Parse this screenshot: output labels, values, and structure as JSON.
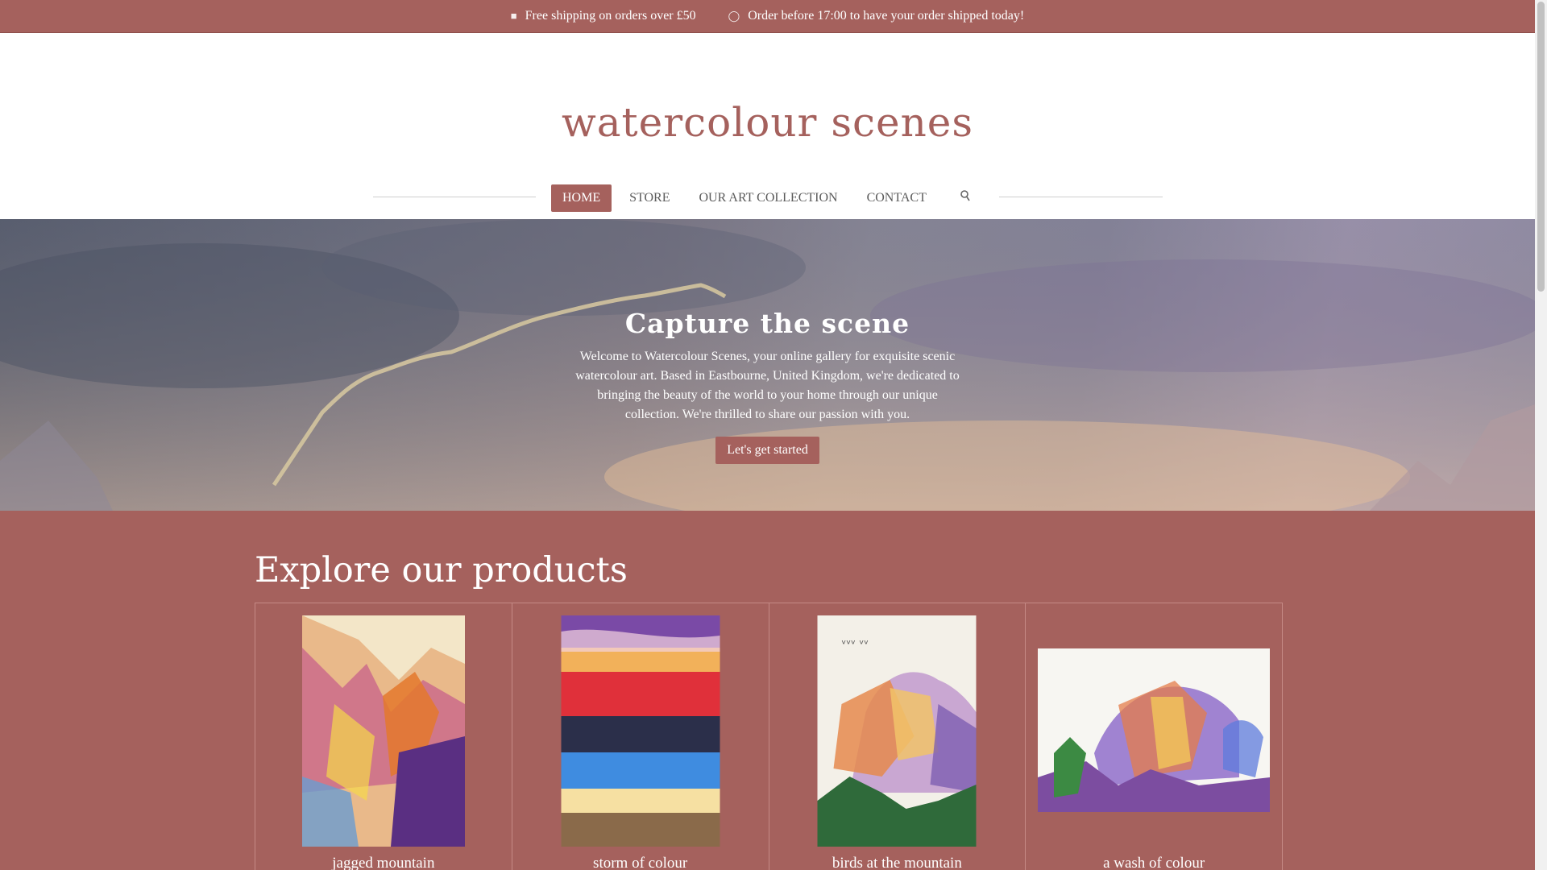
{
  "topbar": {
    "items": [
      {
        "icon": "truck-icon",
        "text": "Free shipping on orders over £50"
      },
      {
        "icon": "clock-icon",
        "text": "Order before 17:00 to have your order shipped today!"
      }
    ]
  },
  "site": {
    "title": "watercolour scenes"
  },
  "nav": {
    "items": [
      "HOME",
      "STORE",
      "OUR ART COLLECTION",
      "CONTACT"
    ],
    "active": "HOME",
    "search_icon": "search-icon"
  },
  "hero": {
    "title": "Capture the scene",
    "text": "Welcome to Watercolour Scenes, your online gallery for exquisite scenic watercolour art. Based in Eastbourne, United Kingdom, we're dedicated to bringing the beauty of the world to your home through our unique collection. We're thrilled to share our passion with you.",
    "button": "Let's get started"
  },
  "products": {
    "title": "Explore our products",
    "items": [
      {
        "name": "jagged mountain"
      },
      {
        "name": "storm of colour"
      },
      {
        "name": "birds at the mountain"
      },
      {
        "name": "a wash of colour"
      }
    ]
  },
  "colors": {
    "accent": "#a5615d",
    "text_muted": "#5b5b5b"
  }
}
